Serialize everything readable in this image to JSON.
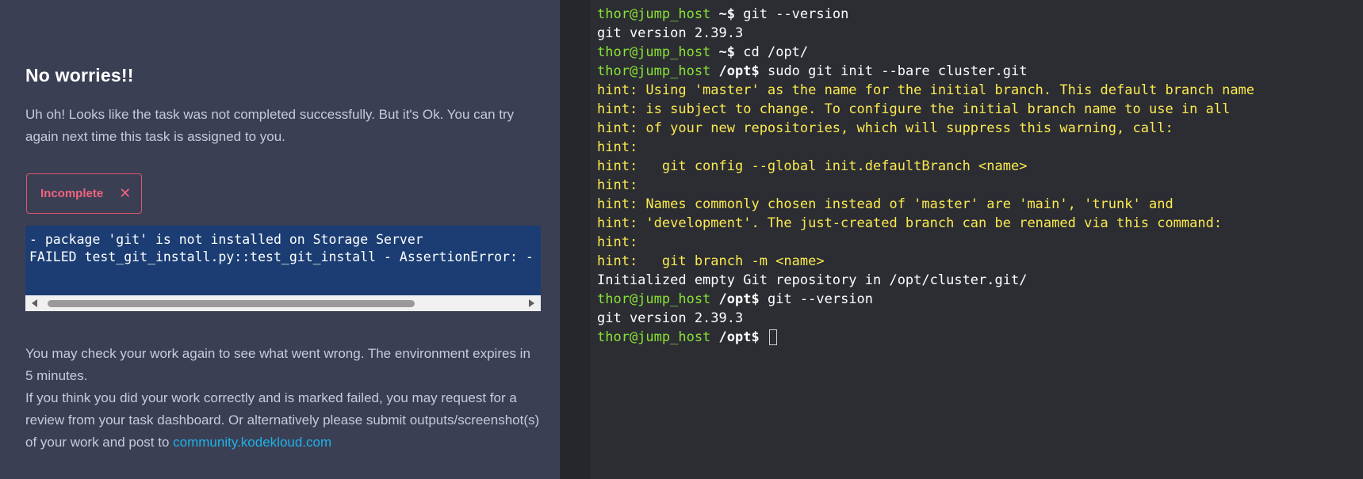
{
  "feedback": {
    "heading": "No worries!!",
    "intro": "Uh oh! Looks like the task was not completed successfully. But it's Ok. You can try again next time this task is assigned to you.",
    "status_badge": "Incomplete",
    "status_icon": "close-icon",
    "log_lines": [
      "- package 'git' is not installed on Storage Server",
      "FAILED test_git_install.py::test_git_install - AssertionError: - package 'git' is not installed on Storage Server"
    ],
    "log_scroll_position": 0,
    "bottom_text_1": "You may check your work again to see what went wrong. The environment expires in 5 minutes.",
    "bottom_text_2": "If you think you did your work correctly and is marked failed, you may request for a review from your task dashboard. Or alternatively please submit outputs/screenshot(s) of your work and post to ",
    "community_link": "community.kodekloud.com"
  },
  "colors": {
    "panel_bg": "#3b3f54",
    "badge_red": "#f0637e",
    "log_bg": "#1b3d73",
    "link": "#1fb1e8",
    "terminal_bg": "#2b2d33",
    "prompt_green": "#8ae234",
    "hint_yellow": "#fce94f"
  },
  "terminal": {
    "lines": [
      {
        "type": "prompt",
        "user": "thor@jump_host",
        "dir": " ~",
        "sym": "$",
        "cmd": " git --version"
      },
      {
        "type": "out",
        "text": "git version 2.39.3"
      },
      {
        "type": "prompt",
        "user": "thor@jump_host",
        "dir": " ~",
        "sym": "$",
        "cmd": " cd /opt/"
      },
      {
        "type": "prompt",
        "user": "thor@jump_host",
        "dir": " /opt",
        "sym": "$",
        "cmd": " sudo git init --bare cluster.git"
      },
      {
        "type": "hint",
        "text": "hint: Using 'master' as the name for the initial branch. This default branch name"
      },
      {
        "type": "hint",
        "text": "hint: is subject to change. To configure the initial branch name to use in all"
      },
      {
        "type": "hint",
        "text": "hint: of your new repositories, which will suppress this warning, call:"
      },
      {
        "type": "hint",
        "text": "hint:"
      },
      {
        "type": "hint",
        "text": "hint:   git config --global init.defaultBranch <name>"
      },
      {
        "type": "hint",
        "text": "hint:"
      },
      {
        "type": "hint",
        "text": "hint: Names commonly chosen instead of 'master' are 'main', 'trunk' and"
      },
      {
        "type": "hint",
        "text": "hint: 'development'. The just-created branch can be renamed via this command:"
      },
      {
        "type": "hint",
        "text": "hint:"
      },
      {
        "type": "hint",
        "text": "hint:   git branch -m <name>"
      },
      {
        "type": "out",
        "text": "Initialized empty Git repository in /opt/cluster.git/"
      },
      {
        "type": "prompt",
        "user": "thor@jump_host",
        "dir": " /opt",
        "sym": "$",
        "cmd": " git --version"
      },
      {
        "type": "out",
        "text": "git version 2.39.3"
      },
      {
        "type": "prompt",
        "user": "thor@jump_host",
        "dir": " /opt",
        "sym": "$",
        "cmd": " ",
        "cursor": true
      }
    ]
  }
}
